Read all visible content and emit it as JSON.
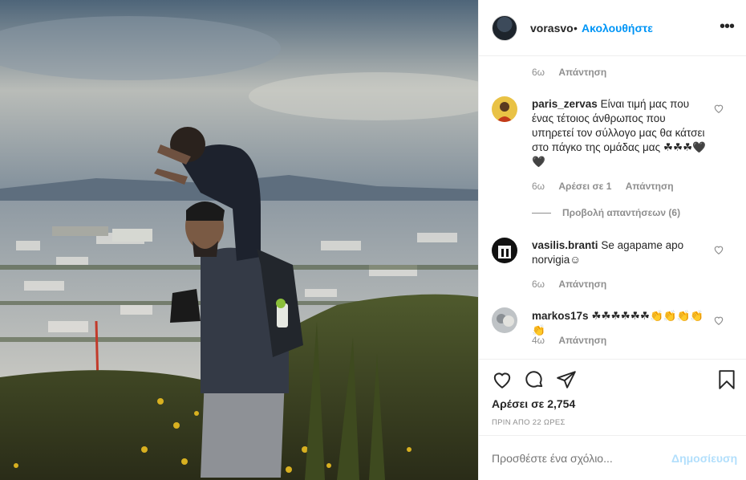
{
  "post": {
    "photo_alt": "",
    "author": {
      "username": "vorasvo",
      "separator": "•",
      "follow_label": "Ακολουθήστε",
      "more_icon": "more-options-icon"
    },
    "caption_meta": {
      "age": "6ω",
      "reply_label": "Απάντηση"
    },
    "comments": [
      {
        "username": "paris_zervas",
        "text": "Είναι τιμή μας που ένας τέτοιος άνθρωπος που υπηρετεί τον σύλλογο μας θα κάτσει στο πάγκο της ομάδας μας ☘☘☘🖤🖤",
        "age": "6ω",
        "likes_label": "Αρέσει σε 1",
        "reply_label": "Απάντηση",
        "view_replies": "Προβολή απαντήσεων (6)"
      },
      {
        "username": "vasilis.branti",
        "text": "Se agapame apo norvigia☺",
        "age": "6ω",
        "reply_label": "Απάντηση"
      },
      {
        "username": "markos17s",
        "text": "☘☘☘☘☘☘👏👏👏👏👏",
        "age": "4ω",
        "reply_label": "Απάντηση"
      }
    ],
    "likes": "Αρέσει σε 2,754",
    "timestamp": "ΠΡΙΝ ΑΠΟ 22 ΩΡΕΣ",
    "add_comment": {
      "placeholder": "Προσθέστε ένα σχόλιο...",
      "post_label": "Δημοσίευση"
    },
    "colors": {
      "link": "#0095f6",
      "muted": "#8e8e8e",
      "text": "#262626",
      "post_disabled": "#b2dffc"
    }
  }
}
